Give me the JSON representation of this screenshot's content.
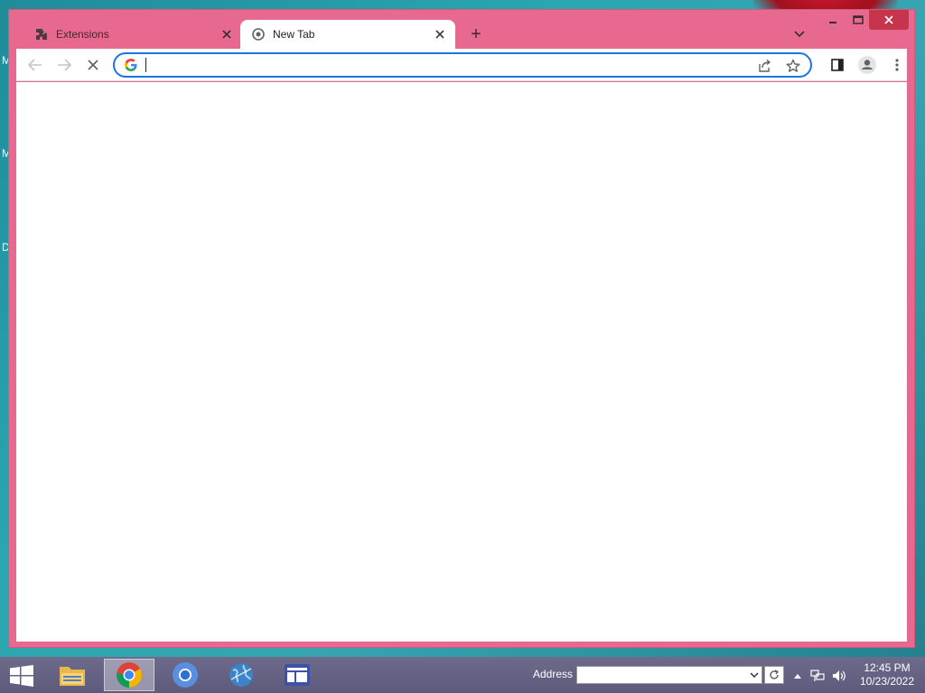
{
  "desktop": {
    "letters": [
      "M",
      "M",
      "D"
    ]
  },
  "browser": {
    "tabs": [
      {
        "title": "Extensions",
        "icon": "puzzle-icon",
        "active": false
      },
      {
        "title": "New Tab",
        "icon": "chrome-icon",
        "active": true
      }
    ],
    "new_tab_symbol": "+",
    "omnibox": {
      "value": "",
      "placeholder": ""
    },
    "colors": {
      "frame": "#e8698f",
      "accent": "#1a73e8",
      "close_button": "#c7354d"
    }
  },
  "taskbar": {
    "address_label": "Address",
    "address_value": "",
    "clock_time": "12:45 PM",
    "clock_date": "10/23/2022"
  }
}
